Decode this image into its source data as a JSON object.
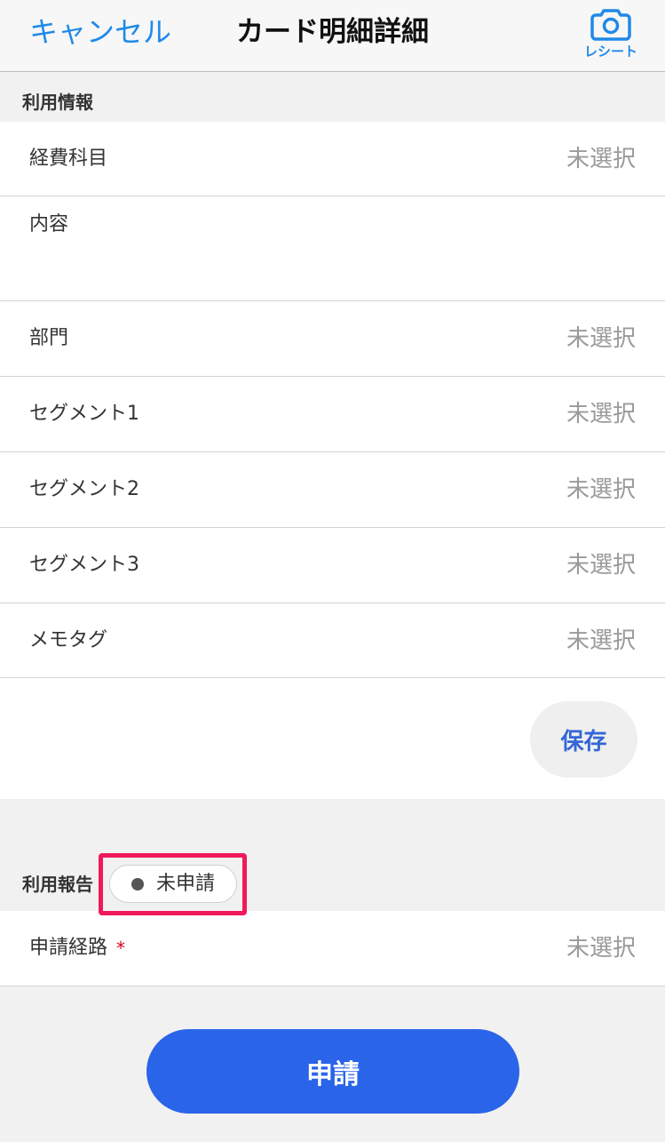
{
  "header": {
    "cancel_label": "キャンセル",
    "title": "カード明細詳細",
    "receipt_label": "レシート",
    "receipt_icon": "camera-icon"
  },
  "usage_info": {
    "section_title": "利用情報",
    "rows": [
      {
        "label": "経費科目",
        "value": "未選択"
      },
      {
        "label": "内容",
        "value": ""
      },
      {
        "label": "部門",
        "value": "未選択"
      },
      {
        "label": "セグメント1",
        "value": "未選択"
      },
      {
        "label": "セグメント2",
        "value": "未選択"
      },
      {
        "label": "セグメント3",
        "value": "未選択"
      },
      {
        "label": "メモタグ",
        "value": "未選択"
      }
    ],
    "save_label": "保存"
  },
  "usage_report": {
    "section_title": "利用報告",
    "status_label": "未申請"
  },
  "approval_route": {
    "label": "申請経路",
    "required_mark": "*",
    "value": "未選択"
  },
  "submit_label": "申請",
  "colors": {
    "accent": "#1f8ae8",
    "primary": "#2a64e8",
    "highlight": "#f0195a",
    "required": "#d0021b",
    "save_text": "#3466d6"
  }
}
